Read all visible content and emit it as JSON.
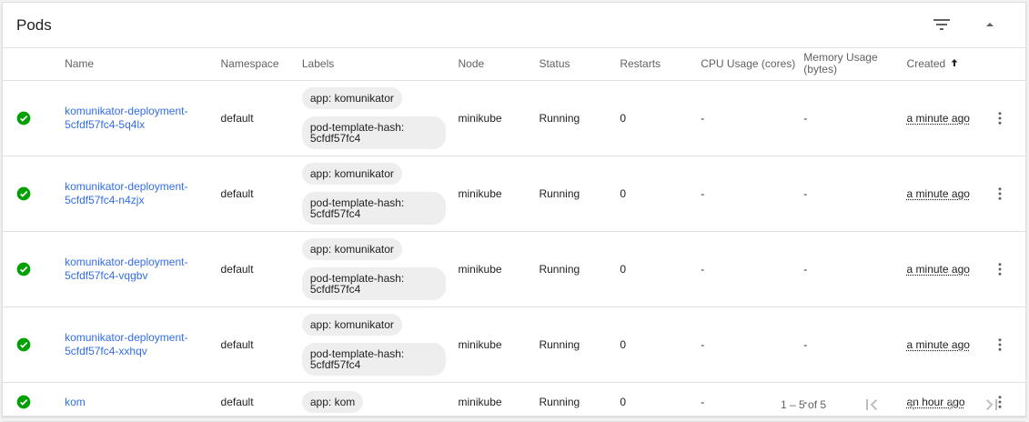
{
  "header": {
    "title": "Pods",
    "filter_icon": "filter-list-icon",
    "collapse_icon": "arrow-drop-up-icon"
  },
  "columns": [
    "Name",
    "Namespace",
    "Labels",
    "Node",
    "Status",
    "Restarts",
    "CPU Usage (cores)",
    "Memory Usage (bytes)",
    "Created"
  ],
  "sort": {
    "column": "Created",
    "direction": "ascending"
  },
  "rows": [
    {
      "name": "komunikator-deployment-5cfdf57fc4-5q4lx",
      "namespace": "default",
      "labels": [
        "app: komunikator",
        "pod-template-hash: 5cfdf57fc4"
      ],
      "node": "minikube",
      "status": "Running",
      "restarts": "0",
      "cpu": "-",
      "memory": "-",
      "created": "a minute ago"
    },
    {
      "name": "komunikator-deployment-5cfdf57fc4-n4zjx",
      "namespace": "default",
      "labels": [
        "app: komunikator",
        "pod-template-hash: 5cfdf57fc4"
      ],
      "node": "minikube",
      "status": "Running",
      "restarts": "0",
      "cpu": "-",
      "memory": "-",
      "created": "a minute ago"
    },
    {
      "name": "komunikator-deployment-5cfdf57fc4-vqgbv",
      "namespace": "default",
      "labels": [
        "app: komunikator",
        "pod-template-hash: 5cfdf57fc4"
      ],
      "node": "minikube",
      "status": "Running",
      "restarts": "0",
      "cpu": "-",
      "memory": "-",
      "created": "a minute ago"
    },
    {
      "name": "komunikator-deployment-5cfdf57fc4-xxhqv",
      "namespace": "default",
      "labels": [
        "app: komunikator",
        "pod-template-hash: 5cfdf57fc4"
      ],
      "node": "minikube",
      "status": "Running",
      "restarts": "0",
      "cpu": "-",
      "memory": "-",
      "created": "a minute ago"
    },
    {
      "name": "kom",
      "namespace": "default",
      "labels": [
        "app: kom"
      ],
      "node": "minikube",
      "status": "Running",
      "restarts": "0",
      "cpu": "-",
      "memory": "-",
      "created": "an hour ago"
    }
  ],
  "pagination": {
    "range": "1 – 5 of 5"
  },
  "colors": {
    "accent": "#326de6",
    "success": "#00a000",
    "border": "#e0e0e0",
    "chip": "#eeeeee"
  }
}
